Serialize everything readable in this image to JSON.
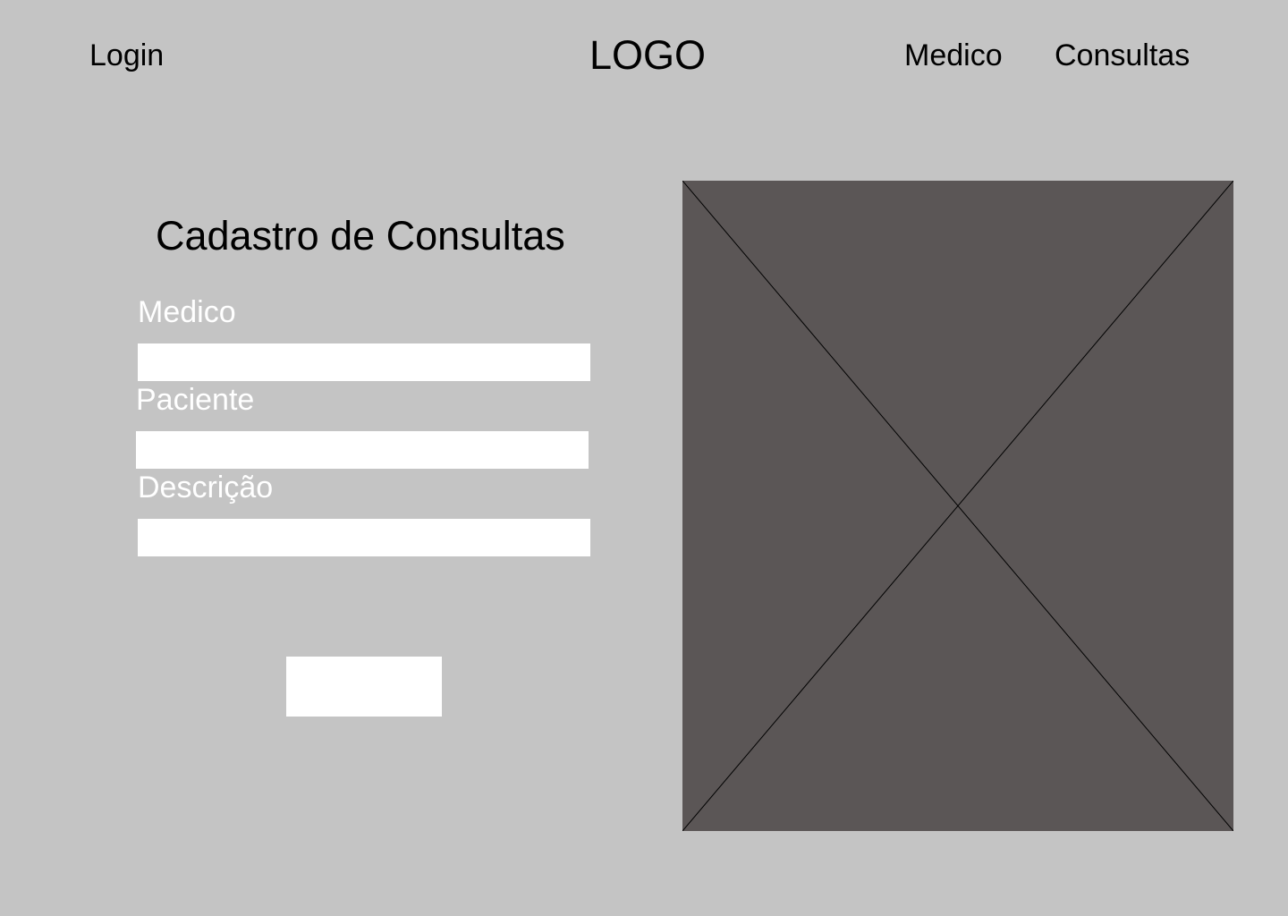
{
  "header": {
    "login_label": "Login",
    "logo_text": "LOGO",
    "nav": {
      "medico_label": "Medico",
      "consultas_label": "Consultas"
    }
  },
  "form": {
    "title": "Cadastro de Consultas",
    "fields": {
      "medico": {
        "label": "Medico",
        "value": "",
        "placeholder": ""
      },
      "paciente": {
        "label": "Paciente",
        "value": "",
        "placeholder": ""
      },
      "descricao": {
        "label": "Descrição",
        "value": "",
        "placeholder": ""
      }
    },
    "submit_label": ""
  },
  "image_placeholder": {
    "fill_color": "#5b5656",
    "line_color": "#000000"
  },
  "colors": {
    "background": "#c4c4c4",
    "input_background": "#ffffff",
    "label_text": "#ffffff",
    "nav_text": "#000000"
  }
}
